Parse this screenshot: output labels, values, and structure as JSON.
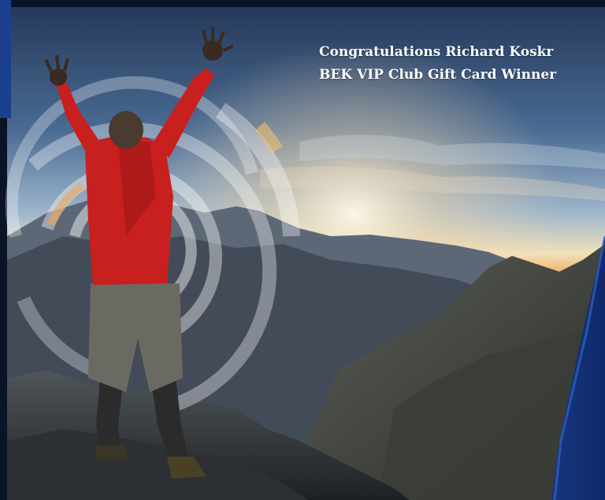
{
  "banner": {
    "line1": "Congratulations Richard Koskr",
    "line2": "BEK VIP Club Gift Card Winner"
  },
  "photo": {
    "subject": "hiker-raising-arms-on-mountain-summit",
    "accent_blue": "#1b3f8f",
    "jacket_red": "#c8201f",
    "sunset_orange": "#f08a2c"
  }
}
